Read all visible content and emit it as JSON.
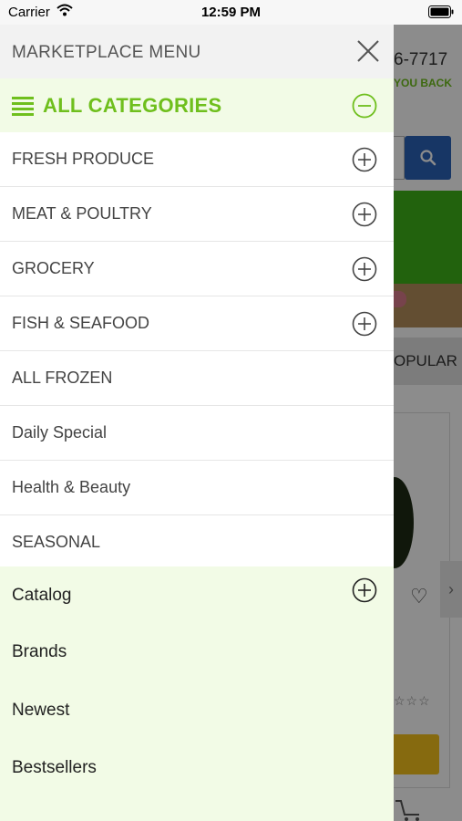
{
  "status_bar": {
    "carrier": "Carrier",
    "time": "12:59 PM"
  },
  "background": {
    "phone": "6-7717",
    "tagline": "YOU BACK",
    "tab_label": "OPULAR",
    "rating_stars": "☆☆☆",
    "brand_color": "#6fbf1d",
    "search_color": "#2b63b9"
  },
  "drawer": {
    "title": "MARKETPLACE MENU",
    "all_categories_label": "ALL CATEGORIES",
    "categories": [
      {
        "label": "FRESH PRODUCE",
        "expandable": true
      },
      {
        "label": "MEAT & POULTRY",
        "expandable": true
      },
      {
        "label": "GROCERY",
        "expandable": true
      },
      {
        "label": "FISH & SEAFOOD",
        "expandable": true
      },
      {
        "label": "ALL FROZEN",
        "expandable": false
      },
      {
        "label": "Daily Special",
        "expandable": false
      },
      {
        "label": "Health & Beauty",
        "expandable": false
      },
      {
        "label": "SEASONAL",
        "expandable": false
      }
    ],
    "links": [
      {
        "label": "Catalog",
        "expandable": true
      },
      {
        "label": "Brands",
        "expandable": false
      },
      {
        "label": "Newest",
        "expandable": false
      },
      {
        "label": "Bestsellers",
        "expandable": false
      }
    ]
  },
  "icons": {
    "close": "close-icon",
    "list": "list-icon",
    "collapse": "minus-circle-icon",
    "expand": "plus-circle-icon",
    "search": "search-icon",
    "heart": "heart-icon",
    "cart": "cart-icon",
    "wifi": "wifi-icon",
    "battery": "battery-icon"
  }
}
